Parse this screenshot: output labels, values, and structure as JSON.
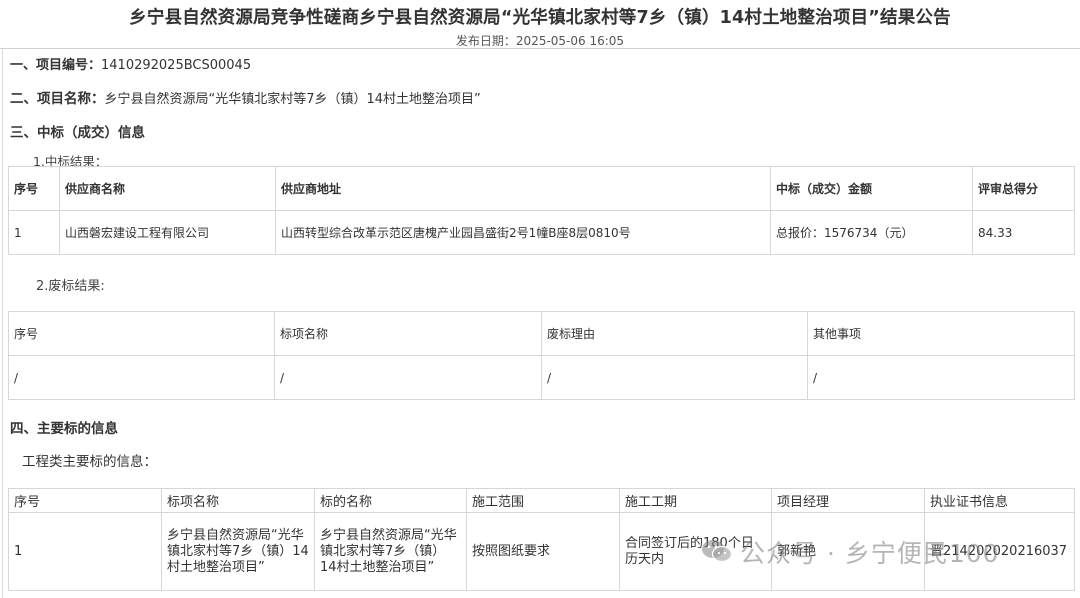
{
  "header": {
    "title": "乡宁县自然资源局竞争性磋商乡宁县自然资源局“光华镇北家村等7乡（镇）14村土地整治项目”结果公告",
    "publish_date": "发布日期：2025-05-06 16:05"
  },
  "section1": {
    "label": "一、项目编号：",
    "value": "1410292025BCS00045"
  },
  "section2": {
    "label": "二、项目名称：",
    "value": "乡宁县自然资源局“光华镇北家村等7乡（镇）14村土地整治项目”"
  },
  "section3": {
    "label": "三、中标（成交）信息",
    "result_label": "1.中标结果：",
    "result_table": {
      "headers": [
        "序号",
        "供应商名称",
        "供应商地址",
        "中标（成交）金额",
        "评审总得分"
      ],
      "rows": [
        [
          "1",
          "山西磐宏建设工程有限公司",
          "山西转型综合改革示范区唐槐产业园昌盛街2号1幢B座8层0810号",
          "总报价：1576734（元）",
          "84.33"
        ]
      ]
    },
    "waste_label": "2.废标结果:",
    "waste_table": {
      "headers": [
        "序号",
        "标项名称",
        "废标理由",
        "其他事项"
      ],
      "rows": [
        [
          "/",
          "/",
          "/",
          "/"
        ]
      ]
    }
  },
  "section4": {
    "label": "四、主要标的信息",
    "sub_label": "工程类主要标的信息：",
    "table": {
      "headers": [
        "序号",
        "标项名称",
        "标的名称",
        "施工范围",
        "施工工期",
        "项目经理",
        "执业证书信息"
      ],
      "rows": [
        [
          "1",
          "乡宁县自然资源局“光华镇北家村等7乡（镇）14村土地整治项目”",
          "乡宁县自然资源局“光华镇北家村等7乡（镇）14村土地整治项目”",
          "按照图纸要求",
          "合同签订后的180个日历天内",
          "郭新艳",
          "晋214202020216037"
        ]
      ]
    }
  },
  "watermark": {
    "text": "公众号 · 乡宁便民100",
    "icon": "wechat-icon"
  }
}
